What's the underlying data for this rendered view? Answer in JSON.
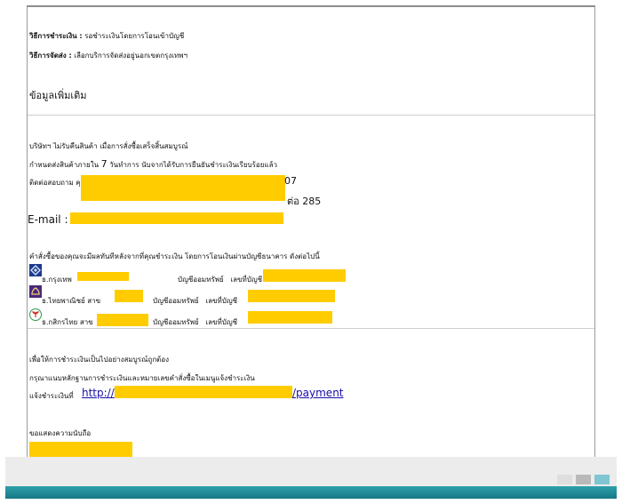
{
  "order": {
    "payment_method_label": "วิธีการชำระเงิน :",
    "payment_method_value": "รอชำระเงินโดยการโอนเข้าบัญชี",
    "shipping_method_label": "วิธีการจัดส่ง :",
    "shipping_method_value": "เลือกบริการจัดส่งอยู่นอกเขตกรุงเทพฯ"
  },
  "additional": {
    "heading": "ข้อมูลเพิ่มเติม",
    "line1": "บริษัทฯ ไม่รับคืนสินค้า เมื่อการสั่งซื้อเสร็จสิ้นสมบูรณ์",
    "line2_pre": "กำหนดส่งสินค้าภายใน",
    "line2_num": "7",
    "line2_post": "วันทำการ นับจากได้รับการยืนยันชำระเงินเรียบร้อยแล้ว",
    "contact_prefix": "ติดต่อสอบถาม คุ",
    "contact_tail1": "07",
    "contact_ext": "ต่อ 285",
    "email_label": "E-mail :"
  },
  "bank": {
    "intro": "คำสั่งซื้อของคุณจะมีผลทันทีหลังจากที่คุณชำระเงิน โดยการโอนเงินผ่านบัญชีธนาคาร ดังต่อไปนี้",
    "accounts": [
      {
        "name": "ธ.กรุงเทพ",
        "type": "บัญชีออมทรัพย์",
        "no_label": "เลขที่บัญชี",
        "icon": "bangkok-bank-icon",
        "color": "#1e3a8a"
      },
      {
        "name": "ธ.ไทยพาณิชย์ สาข",
        "type": "บัญชีออมทรัพย์",
        "no_label": "เลขที่บัญชี",
        "icon": "scb-bank-icon",
        "color": "#4b2a7b"
      },
      {
        "name": "ธ.กสิกรไทย สาข",
        "type": "บัญชีออมทรัพย์",
        "no_label": "เลขที่บัญชี",
        "icon": "kasikorn-bank-icon",
        "color": "#1a8a3a"
      }
    ]
  },
  "instructions": {
    "line1": "เพื่อให้การชำระเงินเป็นไปอย่างสมบูรณ์ถูกต้อง",
    "line2": "กรุณาแนบหลักฐานการชำระเงินและหมายเลขคำสั่งซื้อในเมนูแจ้งชำระเงิน",
    "notify_prefix": "แจ้งชำระเงินที่",
    "link_start": "http://",
    "link_end": "/payment"
  },
  "closing": {
    "thanks": "ขอแสดงความนับถือ"
  },
  "colors": {
    "redaction": "#ffcc00",
    "bar": "#1f8a96",
    "link": "#1a0dab"
  }
}
